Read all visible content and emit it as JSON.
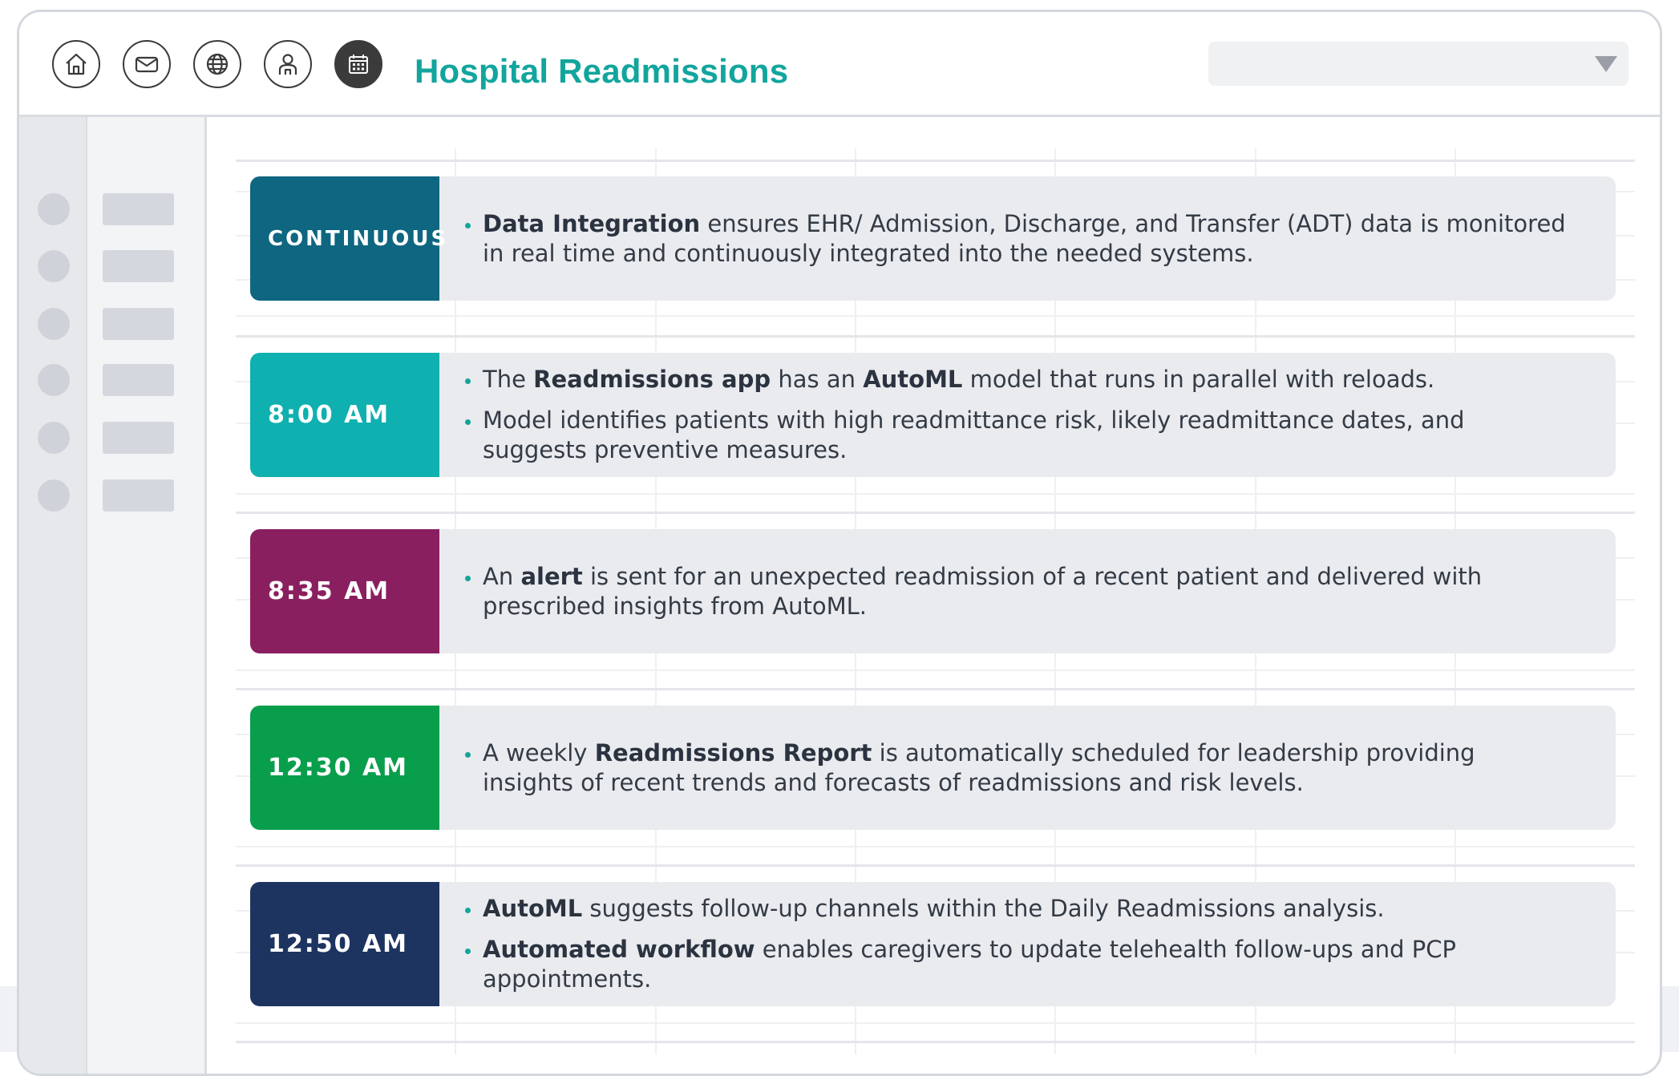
{
  "app": {
    "title": "Hospital Readmissions"
  },
  "toolbar": {
    "icons": [
      "home-icon",
      "mail-icon",
      "globe-icon",
      "user-icon",
      "calendar-icon"
    ],
    "active_icon": "calendar-icon"
  },
  "dropdown": {
    "value": "",
    "icon": "chevron-down-icon"
  },
  "colors": {
    "accent": "#12a59d",
    "continuous": "#0e6680",
    "t0800": "#0fb0b0",
    "t0835": "#8a1f60",
    "t1230": "#099e4c",
    "t1250": "#1d3461",
    "card_body": "#eaebef"
  },
  "timeline": [
    {
      "time": "CONTINUOUS",
      "bullets": [
        [
          {
            "text": "Data Integration",
            "bold": true
          },
          {
            "text": " ensures EHR/ Admission, Discharge, and Transfer (ADT) data is monitored in real time and continuously integrated into the needed systems.",
            "bold": false
          }
        ]
      ]
    },
    {
      "time": "8:00 AM",
      "bullets": [
        [
          {
            "text": "The ",
            "bold": false
          },
          {
            "text": "Readmissions app",
            "bold": true
          },
          {
            "text": " has an ",
            "bold": false
          },
          {
            "text": "AutoML",
            "bold": true
          },
          {
            "text": " model that runs in parallel with reloads.",
            "bold": false
          }
        ],
        [
          {
            "text": "Model identifies patients with high readmittance risk, likely readmittance dates, and suggests preventive measures.",
            "bold": false
          }
        ]
      ]
    },
    {
      "time": "8:35 AM",
      "bullets": [
        [
          {
            "text": "An ",
            "bold": false
          },
          {
            "text": "alert",
            "bold": true
          },
          {
            "text": " is sent for an unexpected readmission of a recent patient and delivered with prescribed insights from AutoML.",
            "bold": false
          }
        ]
      ]
    },
    {
      "time": "12:30 AM",
      "bullets": [
        [
          {
            "text": "A weekly ",
            "bold": false
          },
          {
            "text": "Readmissions Report",
            "bold": true
          },
          {
            "text": " is automatically scheduled for leadership providing insights of recent trends and forecasts of readmissions and risk levels.",
            "bold": false
          }
        ]
      ]
    },
    {
      "time": "12:50 AM",
      "bullets": [
        [
          {
            "text": "AutoML",
            "bold": true
          },
          {
            "text": " suggests follow-up channels within the Daily Readmissions analysis.",
            "bold": false
          }
        ],
        [
          {
            "text": "Automated workflow",
            "bold": true
          },
          {
            "text": " enables caregivers to update telehealth follow-ups and PCP appointments.",
            "bold": false
          }
        ]
      ]
    }
  ]
}
